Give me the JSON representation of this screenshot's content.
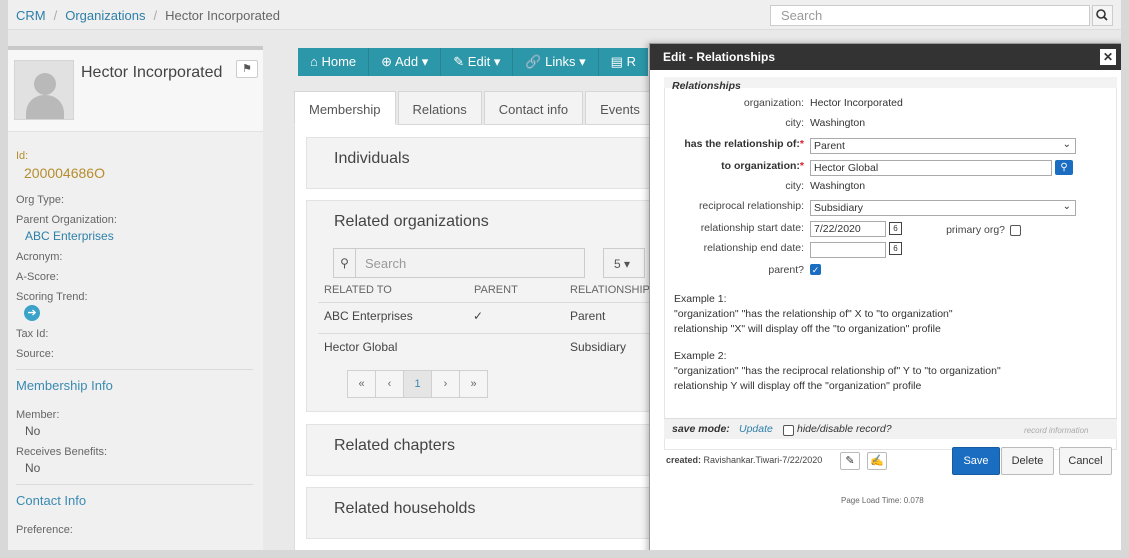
{
  "breadcrumb": [
    "CRM",
    "Organizations",
    "Hector Incorporated"
  ],
  "top_search": {
    "placeholder": "Search"
  },
  "org": {
    "name": "Hector Incorporated",
    "id_label": "Id:",
    "id_value": "200004686O",
    "fields": {
      "org_type": "Org Type:",
      "parent_org_label": "Parent Organization:",
      "parent_org_value": "ABC Enterprises",
      "acronym": "Acronym:",
      "a_score": "A-Score:",
      "scoring_trend": "Scoring Trend:",
      "tax_id": "Tax Id:",
      "source": "Source:"
    },
    "membership": {
      "title": "Membership Info",
      "member_label": "Member:",
      "member_value": "No",
      "benefits_label": "Receives Benefits:",
      "benefits_value": "No"
    },
    "contact": {
      "title": "Contact Info",
      "preference_label": "Preference:"
    }
  },
  "toolbar": {
    "home": "Home",
    "add": "Add",
    "edit": "Edit",
    "links": "Links",
    "reports": "R"
  },
  "tabs": [
    "Membership",
    "Relations",
    "Contact info",
    "Events"
  ],
  "sections": {
    "individuals": "Individuals",
    "related_orgs": "Related organizations",
    "related_chapters": "Related chapters",
    "related_households": "Related households"
  },
  "related_table": {
    "search_placeholder": "Search",
    "page_size": "5",
    "headers": [
      "RELATED TO",
      "PARENT",
      "RELATIONSHIP"
    ],
    "rows": [
      {
        "related_to": "ABC Enterprises",
        "parent": "✓",
        "relationship": "Parent"
      },
      {
        "related_to": "Hector Global",
        "parent": "",
        "relationship": "Subsidiary"
      }
    ],
    "pager": [
      "«",
      "‹",
      "1",
      "›",
      "»"
    ]
  },
  "modal": {
    "title": "Edit - Relationships",
    "section_title": "Relationships",
    "organization_label": "organization:",
    "organization_value": "Hector Incorporated",
    "city_label": "city:",
    "city_value": "Washington",
    "has_rel_label": "has the relationship of:",
    "has_rel_value": "Parent",
    "to_org_label": "to organization:",
    "to_org_value": "Hector Global",
    "to_city_label": "city:",
    "to_city_value": "Washington",
    "reciprocal_label": "reciprocal relationship:",
    "reciprocal_value": "Subsidiary",
    "start_label": "relationship start date:",
    "start_value": "7/22/2020",
    "end_label": "relationship end date:",
    "end_value": "",
    "primary_label": "primary org?",
    "primary_checked": false,
    "parent_label": "parent?",
    "parent_checked": true,
    "example1": [
      "Example 1:",
      "\"organization\" \"has the relationship of\" X to \"to organization\"",
      "relationship \"X\" will display off the \"to organization\" profile"
    ],
    "example2": [
      "Example 2:",
      "\"organization\" \"has the reciprocal relationship of\" Y to \"to organization\"",
      "relationship Y will display off the \"organization\" profile"
    ],
    "save_mode_label": "save mode:",
    "save_mode_value": "Update",
    "hide_label": "hide/disable record?",
    "record_info": "record information",
    "created_label": "created:",
    "created_value": "Ravishankar.Tiwari-7/22/2020",
    "save": "Save",
    "delete": "Delete",
    "cancel": "Cancel",
    "load_time": "Page Load Time: 0.078"
  }
}
